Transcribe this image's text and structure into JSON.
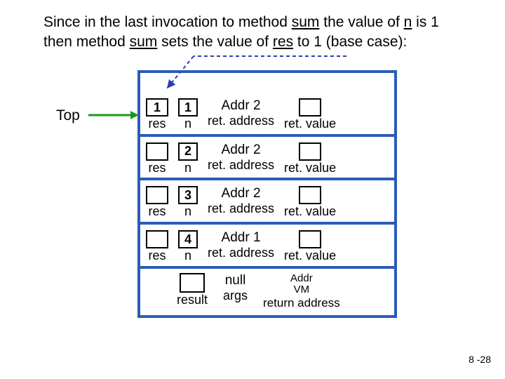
{
  "caption": {
    "pre": "Since in the last invocation to method ",
    "sum1": "sum",
    "mid1": " the value of ",
    "n1": "n",
    "mid2": " is 1 then method ",
    "sum2": "sum",
    "mid3": " sets the value of ",
    "res1": "res",
    "post": " to 1 (base case):"
  },
  "top_label": "Top",
  "frames": [
    {
      "res_val": "1",
      "n_val": "1",
      "addr_val": "Addr 2",
      "addr_lbl": "ret. address",
      "res_lbl": "res",
      "n_lbl": "n",
      "retv_lbl": "ret. value"
    },
    {
      "res_val": "",
      "n_val": "2",
      "addr_val": "Addr 2",
      "addr_lbl": "ret. address",
      "res_lbl": "res",
      "n_lbl": "n",
      "retv_lbl": "ret. value"
    },
    {
      "res_val": "",
      "n_val": "3",
      "addr_val": "Addr 2",
      "addr_lbl": "ret. address",
      "res_lbl": "res",
      "n_lbl": "n",
      "retv_lbl": "ret. value"
    },
    {
      "res_val": "",
      "n_val": "4",
      "addr_val": "Addr 1",
      "addr_lbl": "ret. address",
      "res_lbl": "res",
      "n_lbl": "n",
      "retv_lbl": "ret. value"
    }
  ],
  "bottom": {
    "result_lbl": "result",
    "args_val": "null",
    "args_lbl": "args",
    "addr_line1": "Addr",
    "addr_line2": "VM",
    "addr_lbl": "return address"
  },
  "page_num": "8 -28"
}
